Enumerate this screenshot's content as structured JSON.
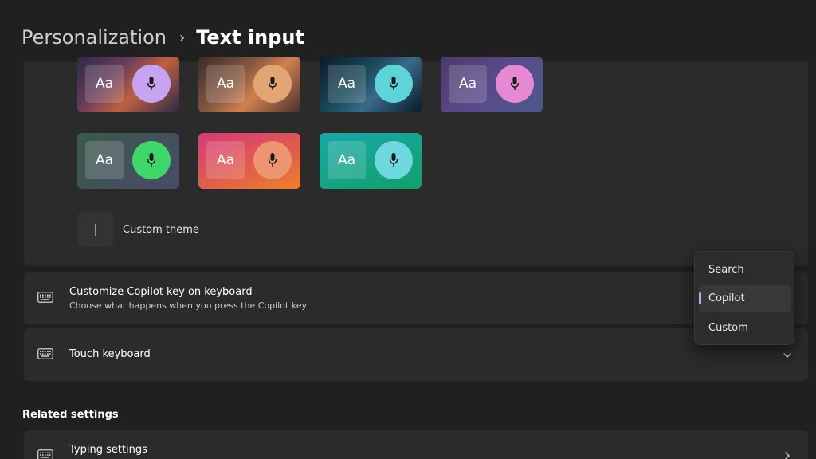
{
  "header": {
    "parent": "Personalization",
    "separator": "›",
    "current": "Text input"
  },
  "themes": [
    {
      "aa": "Aa",
      "bg": "linear-gradient(135deg,#2a2a4a 0%,#6a3c5a 35%,#c06040 60%,#2a2a4a 100%)",
      "mic_color": "#c8a4f0"
    },
    {
      "aa": "Aa",
      "bg": "linear-gradient(135deg,#3a2a2a 0%,#8a5a40 40%,#d08050 60%,#4a3030 100%)",
      "mic_color": "#e2a573"
    },
    {
      "aa": "Aa",
      "bg": "linear-gradient(135deg,#0a1a2a 0%,#1a4a5a 40%,#3a6a8a 60%,#0a1a2a 100%)",
      "mic_color": "#5fd4d8"
    },
    {
      "aa": "Aa",
      "bg": "linear-gradient(135deg,#4a3a6a 0%,#5a4a8a 50%,#4a5a8a 100%)",
      "mic_color": "#e58ad2"
    },
    {
      "aa": "Aa",
      "bg": "linear-gradient(135deg,#3a5a4a 0%,#4a4a6a 100%)",
      "mic_color": "#3ed86a"
    },
    {
      "aa": "Aa",
      "bg": "linear-gradient(160deg,#d63a7a 0%,#e0604a 60%,#f0802a 100%)",
      "mic_color": "#ec9570"
    },
    {
      "aa": "Aa",
      "bg": "linear-gradient(160deg,#1aa8a8 0%,#10a06a 100%)",
      "mic_color": "#6fd8de"
    }
  ],
  "custom_theme": {
    "icon": "+",
    "label": "Custom theme"
  },
  "copilot_key": {
    "icon": "keyboard-icon",
    "title": "Customize Copilot key on keyboard",
    "subtitle": "Choose what happens when you press the Copilot key"
  },
  "touch_keyboard": {
    "icon": "keyboard-icon",
    "title": "Touch keyboard"
  },
  "related": {
    "heading": "Related settings",
    "typing": {
      "icon": "keyboard-icon",
      "title": "Typing settings"
    }
  },
  "flyout": {
    "options": [
      "Search",
      "Copilot",
      "Custom"
    ],
    "selected": "Copilot",
    "accent": "#c7a6f0"
  }
}
